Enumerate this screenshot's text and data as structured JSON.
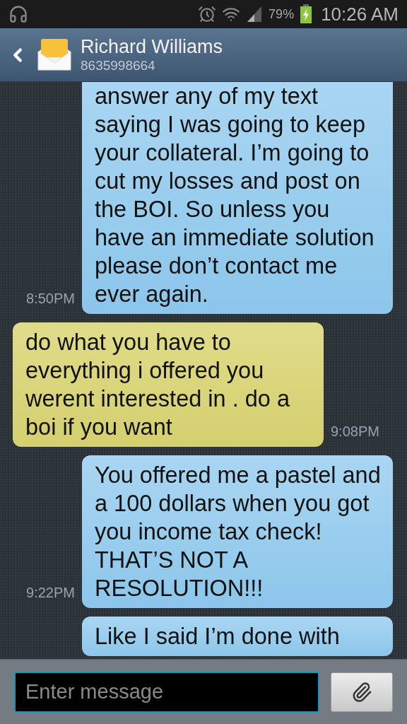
{
  "status_bar": {
    "battery": "79%",
    "time": "10:26 AM"
  },
  "header": {
    "name": "Richard Williams",
    "number": "8635998664"
  },
  "messages": [
    {
      "kind": "outgoing",
      "text": "answer any of my text saying I was going to keep your collateral. I’m going to cut my losses and post on the BOI. So unless you have an immediate solution please don’t contact me ever again.",
      "time": "8:50PM"
    },
    {
      "kind": "incoming",
      "text": "do what you have to everything i offered you werent interested in . do a boi if you want",
      "time": "9:08PM"
    },
    {
      "kind": "outgoing",
      "text": "You offered me a pastel and a 100 dollars when you got you income tax check! THAT’S NOT A RESOLUTION!!!",
      "time": "9:22PM"
    },
    {
      "kind": "outgoing",
      "text": "Like I said I’m done with"
    }
  ],
  "composer": {
    "placeholder": "Enter message"
  }
}
